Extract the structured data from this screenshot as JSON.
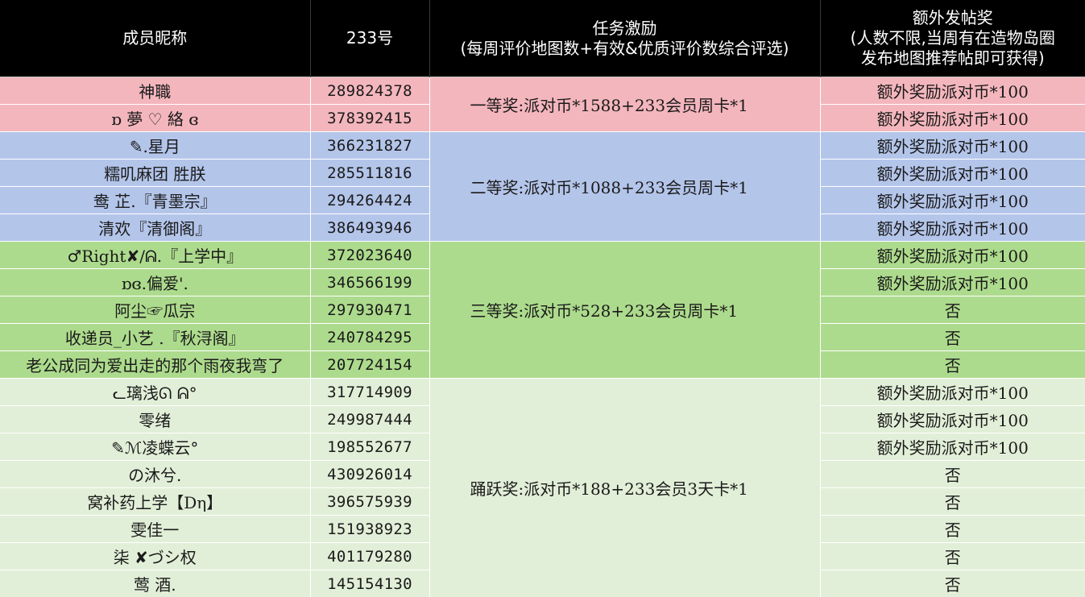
{
  "colors": {
    "header_bg": "#000000",
    "header_text": "#ffffff",
    "tier1": "#f4b6bd",
    "tier2": "#b4c5ea",
    "tier3": "#addb8d",
    "tier4": "#e2efd8"
  },
  "headers": {
    "nickname": "成员昵称",
    "id": "233号",
    "incentive_line1": "任务激励",
    "incentive_line2": "(每周评价地图数+有效&优质评价数综合评选)",
    "bonus_line1": "额外发帖奖",
    "bonus_line2": "(人数不限,当周有在造物岛圈",
    "bonus_line3": "发布地图推荐帖即可获得)"
  },
  "tiers": [
    {
      "reward": "一等奖:派对币*1588+233会员周卡*1",
      "rows": [
        {
          "name": "神職",
          "id": "289824378",
          "bonus": "额外奖励派对币*100"
        },
        {
          "name": "ɒ 夢 ♡ 絡 ɞ",
          "id": "378392415",
          "bonus": "额外奖励派对币*100"
        }
      ]
    },
    {
      "reward": "二等奖:派对币*1088+233会员周卡*1",
      "rows": [
        {
          "name": "✎.星月",
          "id": "366231827",
          "bonus": "额外奖励派对币*100"
        },
        {
          "name": "糯叽麻团  胜朕",
          "id": "285511816",
          "bonus": "额外奖励派对币*100"
        },
        {
          "name": "鸯 芷.『青墨宗』",
          "id": "294264424",
          "bonus": "额外奖励派对币*100"
        },
        {
          "name": "清欢『清御阁』",
          "id": "386493946",
          "bonus": "额外奖励派对币*100"
        }
      ]
    },
    {
      "reward": "三等奖:派对币*528+233会员周卡*1",
      "rows": [
        {
          "name": "♂Right✘/ᕱ.『上学中』",
          "id": "372023640",
          "bonus": "额外奖励派对币*100"
        },
        {
          "name": "ɒɞ.偏爱'.",
          "id": "346566199",
          "bonus": "额外奖励派对币*100"
        },
        {
          "name": "阿尘☞瓜宗",
          "id": "297930471",
          "bonus": "否"
        },
        {
          "name": "收递员_小艺 .『秋浔阁』",
          "id": "240784295",
          "bonus": "否"
        },
        {
          "name": "老公成同为爱出走的那个雨夜我弯了",
          "id": "207724154",
          "bonus": "否"
        }
      ]
    },
    {
      "reward": "踊跃奖:派对币*188+233会员3天卡*1",
      "rows": [
        {
          "name": "ᓚ璃浅ᘏ ᕱ°",
          "id": "317714909",
          "bonus": "额外奖励派对币*100"
        },
        {
          "name": "零绪",
          "id": "249987444",
          "bonus": "额外奖励派对币*100"
        },
        {
          "name": "✎ℳ凌蝶云°",
          "id": "198552677",
          "bonus": "额外奖励派对币*100"
        },
        {
          "name": "の沐兮.",
          "id": "430926014",
          "bonus": "否"
        },
        {
          "name": "窝补药上学【Dη】",
          "id": "396575939",
          "bonus": "否"
        },
        {
          "name": "雯佳一",
          "id": "151938923",
          "bonus": "否"
        },
        {
          "name": "柒 ✘づシ权",
          "id": "401179280",
          "bonus": "否"
        },
        {
          "name": "莺 酒.",
          "id": "145154130",
          "bonus": "否"
        }
      ]
    }
  ]
}
